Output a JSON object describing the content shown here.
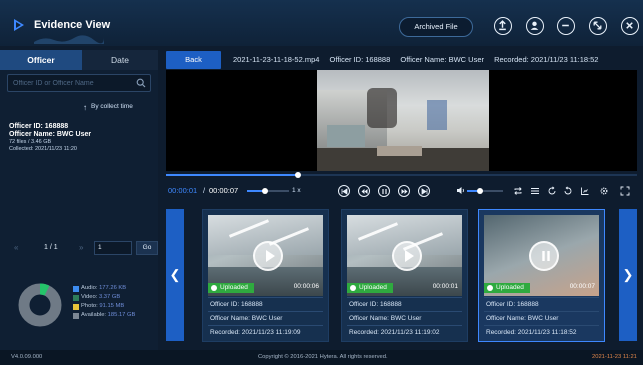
{
  "header": {
    "title": "Evidence View",
    "archived_label": "Archived File",
    "icons": [
      "upload-icon",
      "user-icon",
      "minimize-icon",
      "restore-icon",
      "close-icon"
    ]
  },
  "sidebar": {
    "tabs": [
      {
        "label": "Officer",
        "active": true
      },
      {
        "label": "Date",
        "active": false
      }
    ],
    "search_placeholder": "Officer ID or Officer Name",
    "sort_label": "By collect time",
    "officer": {
      "id": "Officer ID: 168888",
      "name": "Officer Name: BWC User",
      "files": "72 files / 3.46  GB",
      "collected": "Collected: 2021/11/23 11:20"
    },
    "pager": {
      "prev": "«",
      "page": "1 / 1",
      "next": "»",
      "input": "1",
      "go": "Go"
    },
    "storage": [
      {
        "label": "Audio:",
        "value": "177.26  KB",
        "color": "#3d8cf0"
      },
      {
        "label": "Video:",
        "value": "3.37  GB",
        "color": "#2e7d5a"
      },
      {
        "label": "Photo:",
        "value": "91.15  MB",
        "color": "#e8c43a"
      },
      {
        "label": "Available:",
        "value": "185.17  GB",
        "color": "#7c8794"
      }
    ]
  },
  "player": {
    "back_label": "Back",
    "file_name": "2021-11-23-11-18-52.mp4",
    "officer_id": "Officer ID: 168888",
    "officer_name": "Officer Name: BWC User",
    "recorded": "Recorded: 2021/11/23 11:18:52",
    "current_time": "00:00:01",
    "separator": "/",
    "total_time": "00:00:07",
    "speed_label": "1 x",
    "progress_fraction": 0.28,
    "speed_fraction": 0.4,
    "volume_fraction": 0.3,
    "accent": "#3e88ff"
  },
  "thumbnails": [
    {
      "badge": "Uploaded",
      "duration": "00:00:06",
      "officer_id": "Officer ID: 168888",
      "officer_name": "Officer Name: BWC User",
      "recorded": "Recorded: 2021/11/23 11:19:09",
      "state": "play"
    },
    {
      "badge": "Uploaded",
      "duration": "00:00:01",
      "officer_id": "Officer ID: 168888",
      "officer_name": "Officer Name: BWC User",
      "recorded": "Recorded: 2021/11/23 11:19:02",
      "state": "play"
    },
    {
      "badge": "Uploaded",
      "duration": "00:00:07",
      "officer_id": "Officer ID: 168888",
      "officer_name": "Officer Name: BWC User",
      "recorded": "Recorded: 2021/11/23 11:18:52",
      "state": "pause"
    }
  ],
  "nav": {
    "prev": "❮",
    "next": "❯"
  },
  "footer": {
    "version": "V4.0.09.000",
    "copyright": "Copyright © 2016-2021 Hytera. All rights reserved.",
    "clock": "2021-11-23 11:21"
  }
}
